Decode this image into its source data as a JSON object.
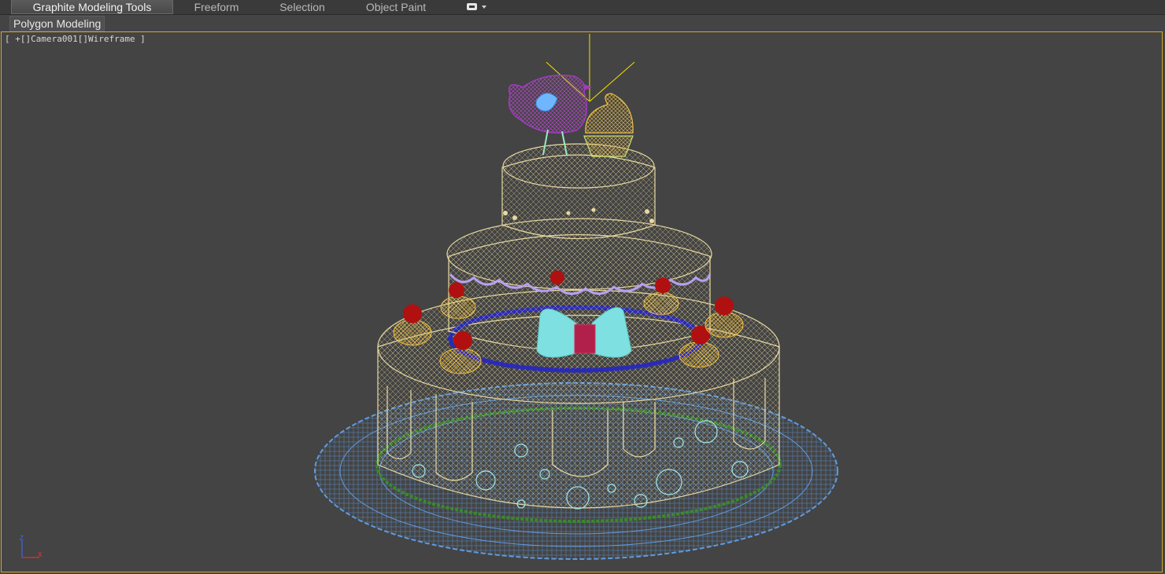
{
  "ribbon": {
    "tabs": [
      {
        "label": "Graphite Modeling Tools",
        "active": true
      },
      {
        "label": "Freeform",
        "active": false
      },
      {
        "label": "Selection",
        "active": false
      },
      {
        "label": "Object Paint",
        "active": false
      }
    ],
    "dropdown_icon": "ribbon-options-icon"
  },
  "panel": {
    "label": "Polygon Modeling"
  },
  "viewport": {
    "label": "[ +[]Camera001[]Wireframe ]",
    "border_color": "#d4a72c",
    "background_color": "#444444"
  },
  "axis_gizmo": {
    "z_label": "Z",
    "x_label": "X"
  },
  "colors": {
    "cake_wire": "#e8d9a0",
    "plate_wire": "#5f9be0",
    "bird_wire": "#a23bbf",
    "bead_wire": "#2a2ab8",
    "cherry_wire": "#b01010",
    "bow_wire": "#7ee0e0",
    "ribbon_green": "#3a8a2a",
    "scallop_lavender": "#b6a0f0",
    "cupcake_wire": "#f0c040"
  }
}
